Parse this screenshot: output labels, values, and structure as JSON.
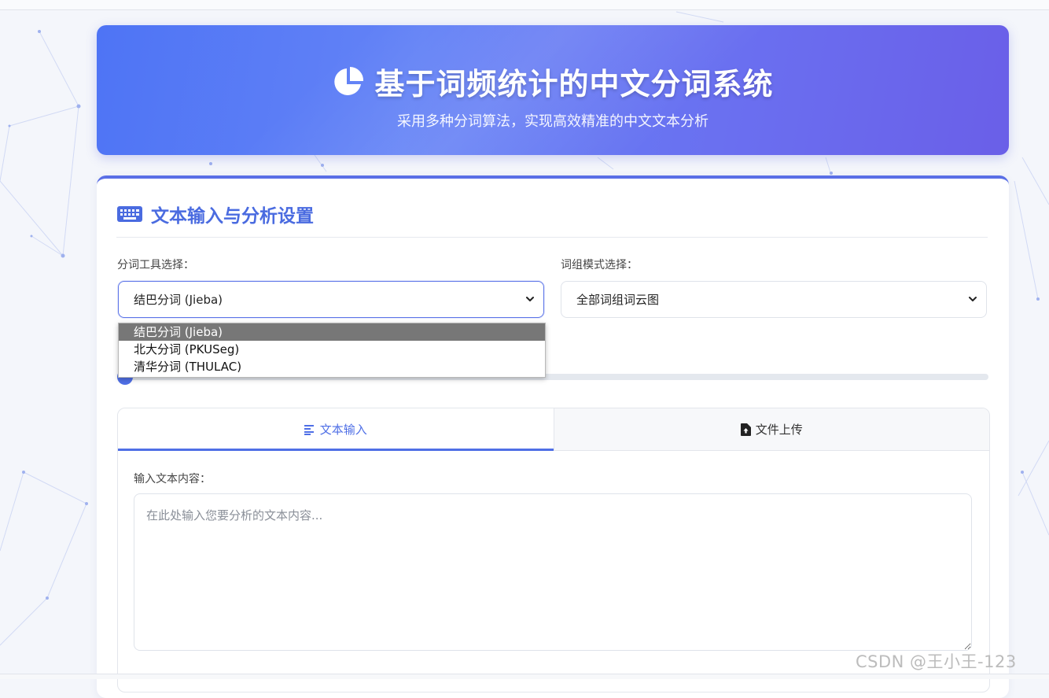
{
  "header": {
    "title": "基于词频统计的中文分词系统",
    "subtitle": "采用多种分词算法，实现高效精准的中文文本分析",
    "icon": "chart-pie-icon"
  },
  "section": {
    "title": "文本输入与分析设置",
    "icon": "keyboard-icon"
  },
  "tool_select": {
    "label": "分词工具选择：",
    "value": "结巴分词 (Jieba)",
    "options": [
      "结巴分词 (Jieba)",
      "北大分词 (PKUSeg)",
      "清华分词 (THULAC)"
    ]
  },
  "mode_select": {
    "label": "词组模式选择：",
    "value": "全部词组词云图"
  },
  "tabs": [
    {
      "label": "文本输入",
      "icon": "align-left-icon",
      "active": true
    },
    {
      "label": "文件上传",
      "icon": "file-upload-icon",
      "active": false
    }
  ],
  "text_input": {
    "label": "输入文本内容：",
    "placeholder": "在此处输入您要分析的文本内容..."
  },
  "watermark": "CSDN @王小王-123",
  "colors": {
    "accent": "#4f6fe6",
    "header_start": "#4e74f5",
    "header_end": "#6a5fe8"
  }
}
